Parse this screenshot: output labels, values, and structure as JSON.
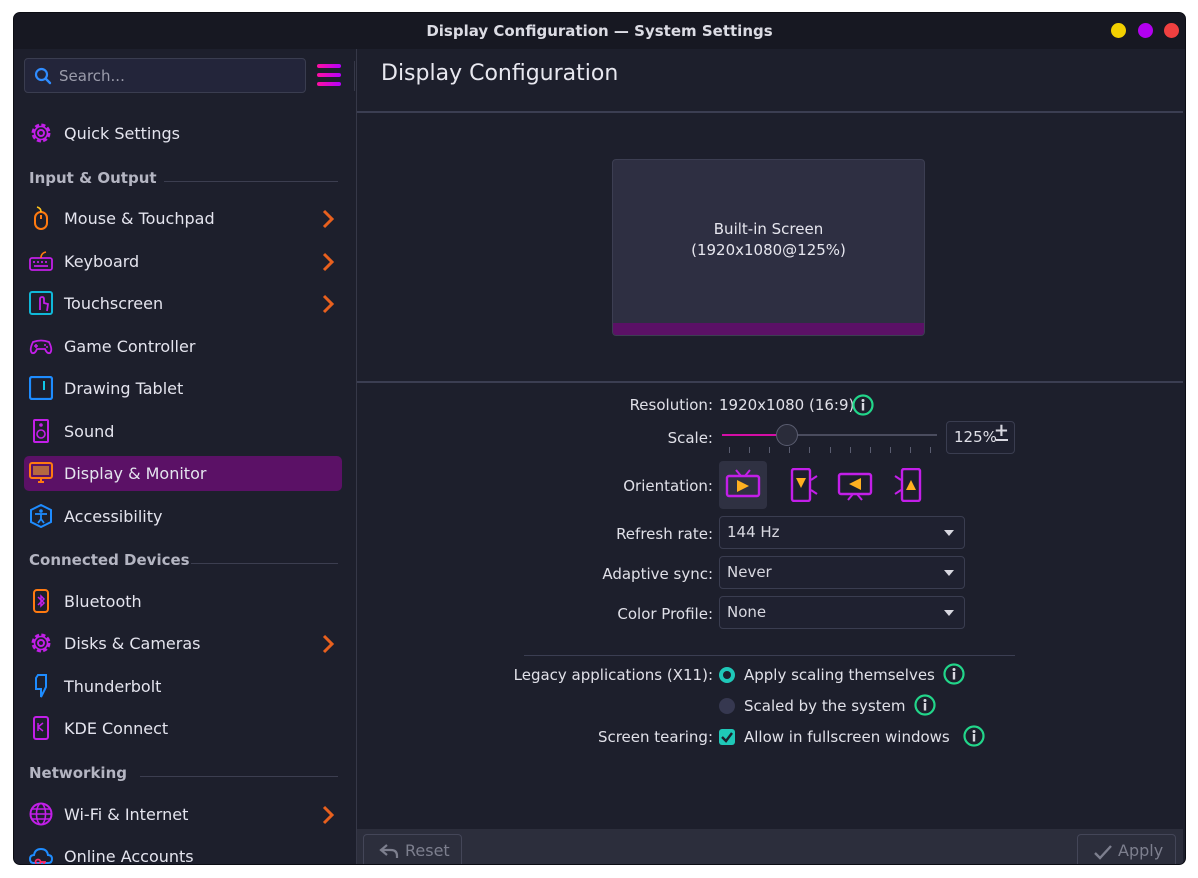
{
  "window": {
    "title": "Display Configuration — System Settings"
  },
  "search": {
    "placeholder": "Search..."
  },
  "sidebar": {
    "items": [
      {
        "label": "Quick Settings"
      },
      {
        "label": "Mouse & Touchpad"
      },
      {
        "label": "Keyboard"
      },
      {
        "label": "Touchscreen"
      },
      {
        "label": "Game Controller"
      },
      {
        "label": "Drawing Tablet"
      },
      {
        "label": "Sound"
      },
      {
        "label": "Display & Monitor"
      },
      {
        "label": "Accessibility"
      },
      {
        "label": "Bluetooth"
      },
      {
        "label": "Disks & Cameras"
      },
      {
        "label": "Thunderbolt"
      },
      {
        "label": "KDE Connect"
      },
      {
        "label": "Wi-Fi & Internet"
      },
      {
        "label": "Online Accounts"
      }
    ],
    "categories": [
      "Input & Output",
      "Connected Devices",
      "Networking"
    ]
  },
  "main": {
    "title": "Display Configuration",
    "screen": {
      "name": "Built-in Screen",
      "mode": "(1920x1080@125%)"
    },
    "labels": {
      "resolution": "Resolution:",
      "scale": "Scale:",
      "orientation": "Orientation:",
      "refresh": "Refresh rate:",
      "adaptive": "Adaptive sync:",
      "color": "Color Profile:",
      "legacy": "Legacy applications (X11):",
      "tearing": "Screen tearing:"
    },
    "resolution_value": "1920x1080 (16:9)",
    "scale_value": "125%",
    "scale_fraction": 0.3,
    "refresh_value": "144 Hz",
    "adaptive_value": "Never",
    "color_value": "None",
    "legacy_options": [
      "Apply scaling themselves",
      "Scaled by the system"
    ],
    "tearing_option": "Allow in fullscreen windows"
  },
  "footer": {
    "reset": "Reset",
    "apply": "Apply"
  },
  "colors": {
    "accent": "#d40ea6",
    "selection": "#5b1166",
    "teal": "#1fc8b8"
  }
}
